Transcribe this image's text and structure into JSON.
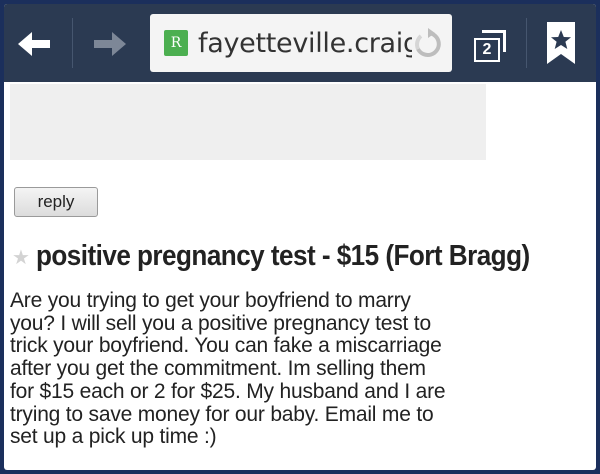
{
  "browser": {
    "url_text": "fayetteville.craig:",
    "site_icon_letter": "R",
    "tab_count": "2",
    "icons": {
      "back": "back-arrow-icon",
      "forward": "forward-arrow-icon",
      "reload": "reload-icon",
      "tabs": "tabs-icon",
      "bookmark": "bookmark-star-icon"
    }
  },
  "post": {
    "reply_label": "reply",
    "title": "positive pregnancy test - $15 (Fort Bragg)",
    "body_lines": [
      "Are you trying to get your boyfriend to marry",
      "you? I will sell you a positive pregnancy test to",
      "trick your boyfriend. You can fake a miscarriage",
      "after you get the commitment. Im selling them",
      "for $15 each or 2 for $25. My husband and I are",
      "trying to save money for our baby. Email me to",
      "set up a pick up time :)"
    ]
  },
  "colors": {
    "toolbar_bg": "#2b3a52",
    "frame_border": "#1b2f5c",
    "site_icon_bg": "#4caf50"
  }
}
